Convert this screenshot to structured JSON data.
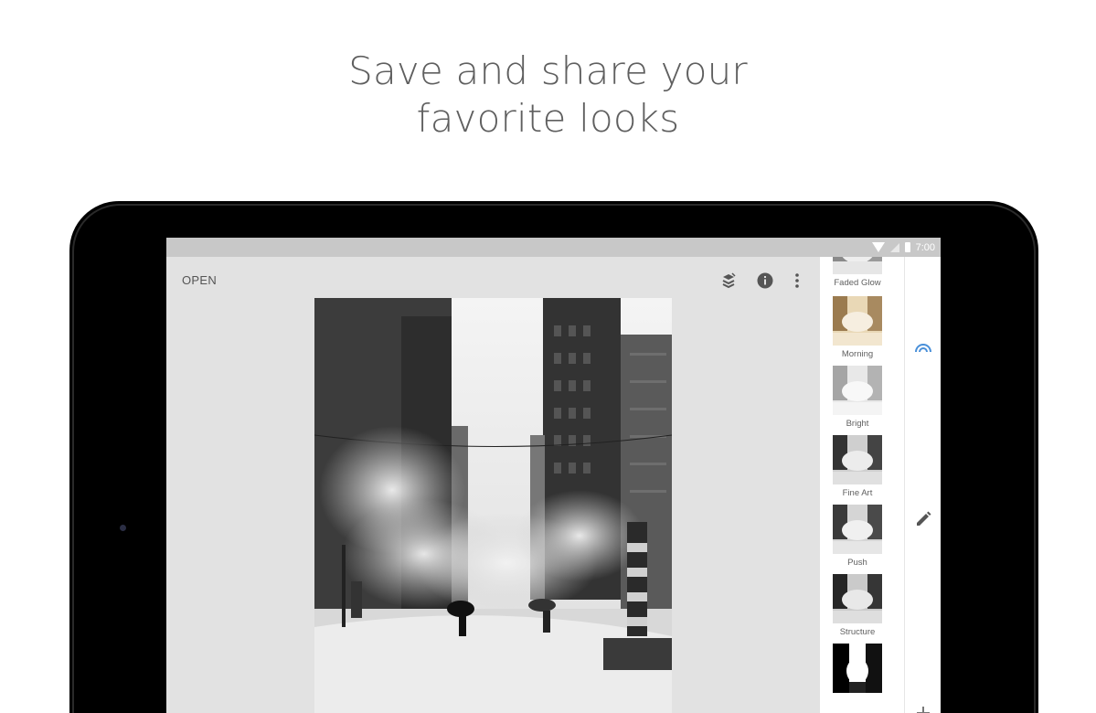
{
  "headline": {
    "line1": "Save and share your",
    "line2": "favorite looks"
  },
  "status_bar": {
    "time": "7:00"
  },
  "toolbar": {
    "open_label": "OPEN",
    "icons": [
      "stack-edit-icon",
      "info-icon",
      "more-vert-icon"
    ]
  },
  "filters": [
    {
      "name": "Faded Glow"
    },
    {
      "name": "Morning"
    },
    {
      "name": "Bright"
    },
    {
      "name": "Fine Art"
    },
    {
      "name": "Push"
    },
    {
      "name": "Structure"
    }
  ],
  "right_panel": {
    "icons": [
      "looks-arc-icon",
      "pencil-icon",
      "plus-icon"
    ]
  },
  "colors": {
    "accent": "#4a90d9",
    "screen_bg": "#e2e2e2",
    "status_bar": "#c8c8c8"
  }
}
